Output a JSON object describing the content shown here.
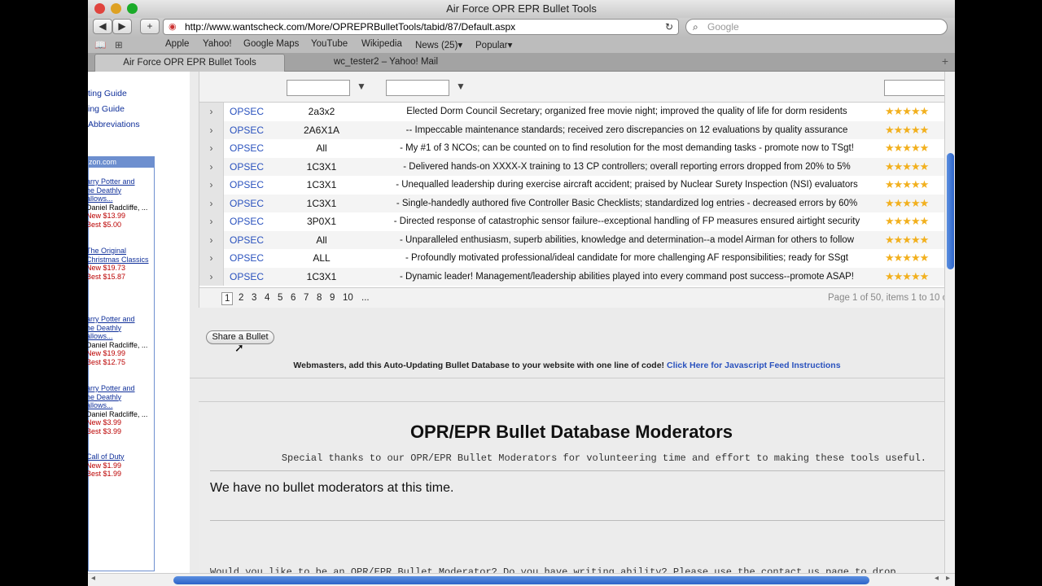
{
  "window": {
    "title": "Air Force OPR EPR Bullet Tools"
  },
  "toolbar": {
    "url": "http://www.wantscheck.com/More/OPREPRBulletTools/tabid/87/Default.aspx",
    "search_placeholder": "Google",
    "back": "◀",
    "forward": "▶",
    "add": "+",
    "reload": "↻"
  },
  "bookmarks": [
    "Apple",
    "Yahoo!",
    "Google Maps",
    "YouTube",
    "Wikipedia",
    "News (25)▾",
    "Popular▾"
  ],
  "tabs": [
    {
      "label": "Air Force OPR EPR Bullet Tools"
    },
    {
      "label": "wc_tester2 – Yahoo! Mail"
    }
  ],
  "sidebar": {
    "nav": [
      "ting Guide",
      "ing Guide",
      "Abbreviations"
    ],
    "amazon_header": "zon.com",
    "products": [
      {
        "title_lines": [
          "arry Potter and",
          "he Deathly",
          "allows..."
        ],
        "author": "Daniel Radcliffe, ...",
        "new": "New $13.99",
        "best": "Best $5.00"
      },
      {
        "title_lines": [
          "The Original",
          "Christmas Classics"
        ],
        "author": "",
        "new": "New $19.73",
        "best": "Best $15.87"
      },
      {
        "title_lines": [
          "arry Potter and",
          "he Deathly",
          "allows..."
        ],
        "author": "Daniel Radcliffe, ...",
        "new": "New $19.99",
        "best": "Best $12.75"
      },
      {
        "title_lines": [
          "arry Potter and",
          "he Deathly",
          "allows..."
        ],
        "author": "Daniel Radcliffe, ...",
        "new": "New $3.99",
        "best": "Best $3.99"
      },
      {
        "title_lines": [
          "Call of Duty"
        ],
        "author": "",
        "new": "New $1.99",
        "best": "Best $1.99"
      }
    ]
  },
  "grid": {
    "filter_icon": "filter-icon",
    "rows": [
      {
        "category": "OPSEC",
        "afsc": "2a3x2",
        "bullet": "Elected Dorm Council Secretary; organized free movie night; improved the quality of life for dorm residents",
        "rating": 5
      },
      {
        "category": "OPSEC",
        "afsc": "2A6X1A",
        "bullet": "-- Impeccable maintenance standards; received zero discrepancies on 12 evaluations by quality assurance",
        "rating": 5
      },
      {
        "category": "OPSEC",
        "afsc": "All",
        "bullet": "- My #1 of 3 NCOs; can be counted on to find resolution for the most demanding tasks - promote now to TSgt!",
        "rating": 5
      },
      {
        "category": "OPSEC",
        "afsc": "1C3X1",
        "bullet": "- Delivered hands-on XXXX-X training to 13 CP controllers; overall reporting errors dropped from 20% to 5%",
        "rating": 5
      },
      {
        "category": "OPSEC",
        "afsc": "1C3X1",
        "bullet": "- Unequalled leadership during exercise aircraft accident; praised by Nuclear Surety Inspection (NSI) evaluators",
        "rating": 5
      },
      {
        "category": "OPSEC",
        "afsc": "1C3X1",
        "bullet": "- Single-handedly authored five Controller Basic Checklists; standardized log entries - decreased errors by 60%",
        "rating": 5
      },
      {
        "category": "OPSEC",
        "afsc": "3P0X1",
        "bullet": "- Directed response of catastrophic sensor failure--exceptional handling of FP measures ensured airtight security",
        "rating": 5
      },
      {
        "category": "OPSEC",
        "afsc": "All",
        "bullet": "- Unparalleled enthusiasm, superb abilities, knowledge and determination--a model Airman for others to follow",
        "rating": 5
      },
      {
        "category": "OPSEC",
        "afsc": "ALL",
        "bullet": "- Profoundly motivated professional/ideal candidate for more challenging AF responsibilities; ready for SSgt",
        "rating": 5
      },
      {
        "category": "OPSEC",
        "afsc": "1C3X1",
        "bullet": "- Dynamic leader! Management/leadership abilities played into every command post success--promote ASAP!",
        "rating": 5
      }
    ],
    "pager": {
      "pages": [
        "1",
        "2",
        "3",
        "4",
        "5",
        "6",
        "7",
        "8",
        "9",
        "10",
        "..."
      ],
      "current": "1",
      "info": "Page 1 of 50, items 1 to 10 o"
    }
  },
  "share_button": "Share a Bullet",
  "webmasters": {
    "text": "Webmasters, add this Auto-Updating Bullet Database to your website with one line of code!",
    "link": "Click Here for Javascript Feed Instructions"
  },
  "moderators": {
    "title": "OPR/EPR Bullet Database Moderators",
    "subtitle": "Special thanks to our OPR/EPR Bullet Moderators for volunteering time and effort to making these tools useful.",
    "none": "We have no bullet moderators at this time.",
    "ask": "Would you like to be an OPR/EPR Bullet Moderator?  Do you have writing ability?  Please use the contact us page to drop"
  },
  "colors": {
    "link": "#2a52be",
    "star": "#f2b01e",
    "scroll_thumb": "#2d64c8"
  }
}
